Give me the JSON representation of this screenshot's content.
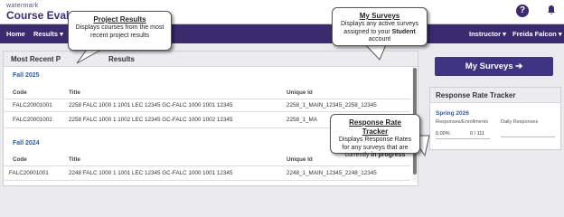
{
  "header": {
    "brand_small": "watermark",
    "brand_big": "Course Evaluati",
    "help_icon": "question-circle-icon",
    "bell_icon": "bell-icon"
  },
  "nav": {
    "home": "Home",
    "results": "Results ▾",
    "instructor": "Instructor ▾",
    "user": "Freida Falcon ▾"
  },
  "main": {
    "header_left": "Most Recent P",
    "header_right": "Results",
    "columns": {
      "code": "Code",
      "title": "Title",
      "unique_id": "Unique Id"
    },
    "terms": [
      {
        "label": "Fall 2025",
        "rows": [
          {
            "code": "FALC20001001",
            "title": "2258 FALC 1000 1 1001 LEC 12345 GC-FALC 1000 1001 12345",
            "unique_id": "2258_1_MAIN_12345_2258_12345"
          },
          {
            "code": "FALC20001002",
            "title": "2258 FALC 1000 1 1002 LEC 12345 GC-FALC 1000 1002 12345",
            "unique_id": "2258_1_MA"
          }
        ]
      },
      {
        "label": "Fall 2024",
        "rows": [
          {
            "code": "FALC20001001",
            "title": "2248 FALC 1000 1 1001 LEC 12345 GC-FALC 1000 1001 12345",
            "unique_id": "2248_1_MAIN_12345_2248_12345"
          }
        ]
      }
    ]
  },
  "sidebar": {
    "my_surveys_button": "My Surveys  ➔",
    "rrt_title": "Response Rate Tracker",
    "rrt_term": "Spring 2026",
    "rrt_col1": "Responses/Enrollments",
    "rrt_col2": "Daily Responses",
    "rrt_pct": "0.00%",
    "rrt_count": "0 / 111"
  },
  "callouts": {
    "project_results": {
      "title": "Project Results",
      "body": "Displays courses from the most recent project results"
    },
    "my_surveys": {
      "title": "My Surveys",
      "body_before": "Displays any active surveys assigned to your",
      "body_bold": "Student",
      "body_after": "account"
    },
    "rrt": {
      "title": "Response Rate Tracker",
      "body_before": "Displays Response Rates for any surveys that are currently",
      "body_bold": "in progress"
    }
  },
  "colors": {
    "nav_bg": "#3b2a6e",
    "button_bg": "#3f3484",
    "term_link": "#2c5aa0"
  }
}
